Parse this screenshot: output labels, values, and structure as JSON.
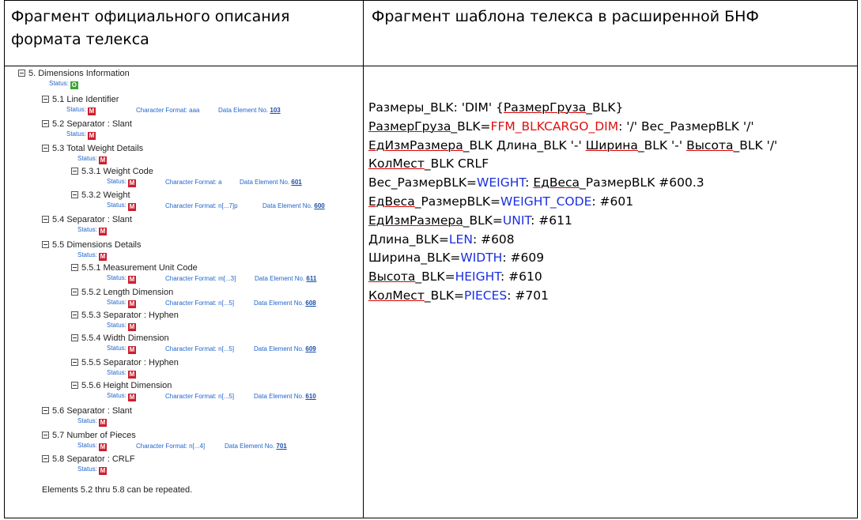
{
  "header": {
    "left_title": "Фрагмент официального описания формата телекса",
    "right_title": "Фрагмент шаблона телекса в расширенной БНФ"
  },
  "spec": {
    "root": {
      "label": "5.  Dimensions Information",
      "status_label": "Status:",
      "badge": "O"
    },
    "items": [
      {
        "label": "5.1 Line Identifier",
        "status_label": "Status:",
        "badge": "M",
        "format": "Character Format: aaa",
        "de_label": "Data Element No.",
        "de": "103"
      },
      {
        "label": "5.2 Separator : Slant",
        "status_label": "Status:",
        "badge": "M"
      },
      {
        "label": "5.3 Total Weight Details",
        "status_label": "Status:",
        "badge": "M"
      },
      {
        "label": "5.3.1 Weight Code",
        "status_label": "Status:",
        "badge": "M",
        "format": "Character Format: a",
        "de_label": "Data Element No.",
        "de": "601"
      },
      {
        "label": "5.3.2 Weight",
        "status_label": "Status:",
        "badge": "M",
        "format": "Character Format: n[...7]p",
        "de_label": "Data Element No.",
        "de": "600"
      },
      {
        "label": "5.4 Separator : Slant",
        "status_label": "Status:",
        "badge": "M"
      },
      {
        "label": "5.5 Dimensions Details",
        "status_label": "Status:",
        "badge": "M"
      },
      {
        "label": "5.5.1 Measurement Unit Code",
        "status_label": "Status:",
        "badge": "M",
        "format": "Character Format: m[...3]",
        "de_label": "Data Element No.",
        "de": "611"
      },
      {
        "label": "5.5.2 Length Dimension",
        "status_label": "Status:",
        "badge": "M",
        "format": "Character Format: n[...5]",
        "de_label": "Data Element No.",
        "de": "608"
      },
      {
        "label": "5.5.3 Separator : Hyphen",
        "status_label": "Status:",
        "badge": "M"
      },
      {
        "label": "5.5.4 Width Dimension",
        "status_label": "Status:",
        "badge": "M",
        "format": "Character Format: n[...5]",
        "de_label": "Data Element No.",
        "de": "609"
      },
      {
        "label": "5.5.5 Separator : Hyphen",
        "status_label": "Status:",
        "badge": "M"
      },
      {
        "label": "5.5.6 Height Dimension",
        "status_label": "Status:",
        "badge": "M",
        "format": "Character Format: n[...5]",
        "de_label": "Data Element No.",
        "de": "610"
      },
      {
        "label": "5.6 Separator : Slant",
        "status_label": "Status:",
        "badge": "M"
      },
      {
        "label": "5.7 Number of Pieces",
        "status_label": "Status:",
        "badge": "M",
        "format": "Character Format: n[...4]",
        "de_label": "Data Element No.",
        "de": "701"
      },
      {
        "label": "5.8 Separator : CRLF",
        "status_label": "Status:",
        "badge": "M"
      }
    ],
    "footnote": "Elements 5.2 thru 5.8 can be repeated."
  },
  "grammar": {
    "l1": {
      "a": "Размеры_BLK: 'DIM' {",
      "b": "РазмерГруза",
      "c": "_BLK}"
    },
    "l2": {
      "a": "РазмерГруза",
      "b": "_BLK=",
      "c": "FFM_BLKCARGO_DIM",
      "d": ": '/' Вес_РазмерBLK '/'"
    },
    "l3": {
      "a": "ЕдИзмРазмера",
      "b": "_BLK Длина_BLK '-' ",
      "c": "Ширина",
      "d": "_BLK '-' ",
      "e": "Высота",
      "f": "_BLK '/'"
    },
    "l4": {
      "a": "КолМест",
      "b": "_BLK CRLF"
    },
    "l5": {
      "a": "Вес_РазмерBLK=",
      "b": "WEIGHT",
      "c": ": ",
      "d": "ЕдВеса",
      "e": "_РазмерBLK #600.3"
    },
    "l6": {
      "a": "ЕдВеса",
      "b": "_РазмерBLK=",
      "c": "WEIGHT_CODE",
      "d": ": #601"
    },
    "l7": {
      "a": "ЕдИзмРазмера",
      "b": "_BLK=",
      "c": "UNIT",
      "d": ": #611"
    },
    "l8": {
      "a": "Длина_BLK=",
      "b": "LEN",
      "c": ": #608"
    },
    "l9": {
      "a": "Ширина_BLK=",
      "b": "WIDTH",
      "c": ": #609"
    },
    "l10": {
      "a": "Высота",
      "b": "_BLK=",
      "c": "HEIGHT",
      "d": ": #610"
    },
    "l11": {
      "a": "КолМест",
      "b": "_BLK=",
      "c": "PIECES",
      "d": ": #701"
    }
  }
}
